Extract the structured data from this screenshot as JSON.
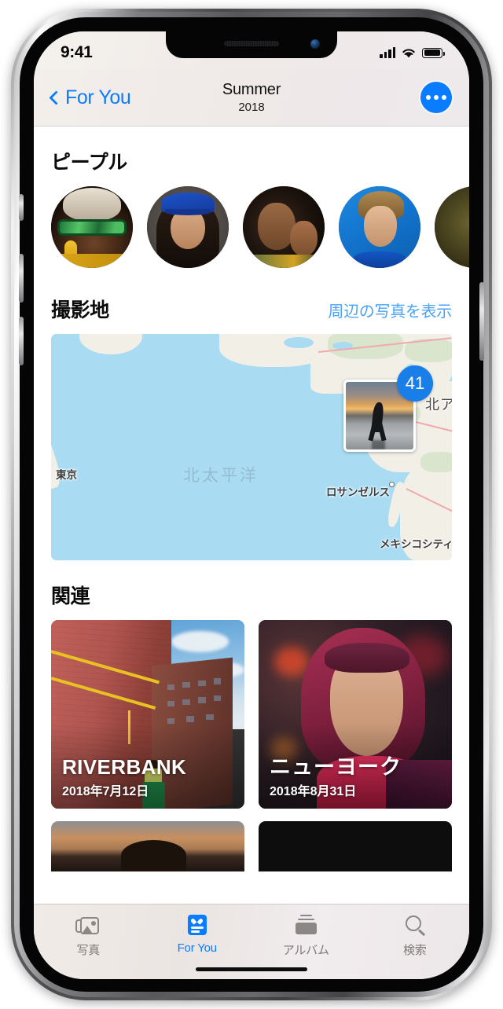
{
  "status_bar": {
    "time": "9:41",
    "signal_icon": "cellular-bars-icon",
    "wifi_icon": "wifi-icon",
    "battery_icon": "battery-full-icon"
  },
  "nav_bar": {
    "back_label": "For You",
    "back_icon": "chevron-left-icon",
    "title": "Summer",
    "subtitle": "2018",
    "more_icon": "ellipsis-icon"
  },
  "sections": {
    "people": {
      "title": "ピープル",
      "avatars": [
        {
          "name": "person-sunglasses"
        },
        {
          "name": "person-blue-cap"
        },
        {
          "name": "person-two-children"
        },
        {
          "name": "person-blue-backdrop"
        },
        {
          "name": "person-partial"
        }
      ]
    },
    "places": {
      "title": "撮影地",
      "action_label": "周辺の写真を表示",
      "map": {
        "photo_count": "41",
        "thumbnail_name": "beach-sunset-thumbnail",
        "labels": [
          {
            "text": "東京",
            "kind": "city"
          },
          {
            "text": "北太平洋",
            "kind": "ocean"
          },
          {
            "text": "ロサンゼルス",
            "kind": "city"
          },
          {
            "text": "メキシコシティ",
            "kind": "city"
          },
          {
            "text": "北ア",
            "kind": "continent"
          }
        ]
      }
    },
    "related": {
      "title": "関連",
      "cards": [
        {
          "title": "RIVERBANK",
          "date": "2018年7月12日",
          "art": "riverbank"
        },
        {
          "title": "ニューヨーク",
          "date": "2018年8月31日",
          "art": "newyork"
        }
      ]
    }
  },
  "tab_bar": {
    "tabs": [
      {
        "label": "写真",
        "icon": "photos-icon",
        "active": false
      },
      {
        "label": "For You",
        "icon": "foryou-icon",
        "active": true
      },
      {
        "label": "アルバム",
        "icon": "albums-icon",
        "active": false
      },
      {
        "label": "検索",
        "icon": "search-icon",
        "active": false
      }
    ]
  },
  "colors": {
    "accent": "#0a7cff",
    "badge": "#1a7ee8",
    "link": "#4aa3f5",
    "ocean": "#a9dcf3",
    "land": "#f2efe6"
  }
}
